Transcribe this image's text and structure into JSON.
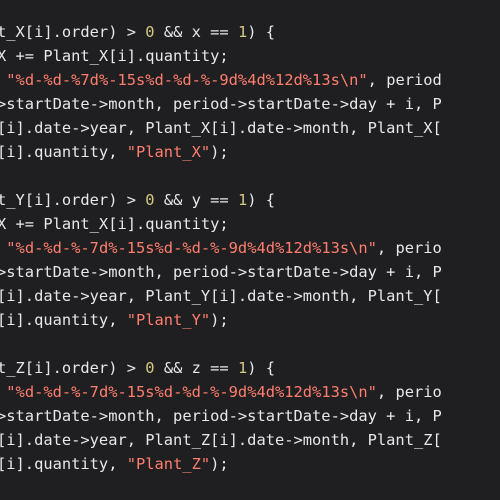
{
  "editor": {
    "theme": {
      "background": "#1f1f21",
      "text": "#e8e8e8",
      "number": "#d6c784",
      "string": "#ff7e6e"
    },
    "lines": [
      {
        "parts": [
          {
            "t": "plain",
            "v": "t_X[i].order) > "
          },
          {
            "t": "num",
            "v": "0"
          },
          {
            "t": "plain",
            "v": " && x == "
          },
          {
            "t": "num",
            "v": "1"
          },
          {
            "t": "plain",
            "v": ") {"
          }
        ]
      },
      {
        "parts": [
          {
            "t": "plain",
            "v": "X += Plant_X[i].quantity;"
          }
        ]
      },
      {
        "parts": [
          {
            "t": "plain",
            "v": " "
          },
          {
            "t": "str",
            "v": "\"%d-%d-%7d%-15s%d-%d-%-9d%4d%12d%13s\\n\""
          },
          {
            "t": "plain",
            "v": ", period"
          }
        ]
      },
      {
        "parts": [
          {
            "t": "plain",
            "v": ">startDate->month, period->startDate->day + i, P"
          }
        ]
      },
      {
        "parts": [
          {
            "t": "plain",
            "v": "[i].date->year, Plant_X[i].date->month, Plant_X["
          }
        ]
      },
      {
        "parts": [
          {
            "t": "plain",
            "v": "[i].quantity, "
          },
          {
            "t": "str",
            "v": "\"Plant_X\""
          },
          {
            "t": "plain",
            "v": ");"
          }
        ]
      },
      {
        "parts": []
      },
      {
        "parts": [
          {
            "t": "plain",
            "v": "t_Y[i].order) > "
          },
          {
            "t": "num",
            "v": "0"
          },
          {
            "t": "plain",
            "v": " && y == "
          },
          {
            "t": "num",
            "v": "1"
          },
          {
            "t": "plain",
            "v": ") {"
          }
        ]
      },
      {
        "parts": [
          {
            "t": "plain",
            "v": "X += Plant_X[i].quantity;"
          }
        ]
      },
      {
        "parts": [
          {
            "t": "plain",
            "v": " "
          },
          {
            "t": "str",
            "v": "\"%d-%d-%-7d%-15s%d-%d-%-9d%4d%12d%13s\\n\""
          },
          {
            "t": "plain",
            "v": ", perio"
          }
        ]
      },
      {
        "parts": [
          {
            "t": "plain",
            "v": ">startDate->month, period->startDate->day + i, P"
          }
        ]
      },
      {
        "parts": [
          {
            "t": "plain",
            "v": "[i].date->year, Plant_Y[i].date->month, Plant_Y["
          }
        ]
      },
      {
        "parts": [
          {
            "t": "plain",
            "v": "[i].quantity, "
          },
          {
            "t": "str",
            "v": "\"Plant_Y\""
          },
          {
            "t": "plain",
            "v": ");"
          }
        ]
      },
      {
        "parts": []
      },
      {
        "parts": [
          {
            "t": "plain",
            "v": "t_Z[i].order) > "
          },
          {
            "t": "num",
            "v": "0"
          },
          {
            "t": "plain",
            "v": " && z == "
          },
          {
            "t": "num",
            "v": "1"
          },
          {
            "t": "plain",
            "v": ") {"
          }
        ]
      },
      {
        "parts": [
          {
            "t": "plain",
            "v": " "
          },
          {
            "t": "str",
            "v": "\"%d-%d-%-7d%-15s%d-%d-%-9d%4d%12d%13s\\n\""
          },
          {
            "t": "plain",
            "v": ", perio"
          }
        ]
      },
      {
        "parts": [
          {
            "t": "plain",
            "v": ">startDate->month, period->startDate->day + i, P"
          }
        ]
      },
      {
        "parts": [
          {
            "t": "plain",
            "v": "[i].date->year, Plant_Z[i].date->month, Plant_Z["
          }
        ]
      },
      {
        "parts": [
          {
            "t": "plain",
            "v": "[i].quantity, "
          },
          {
            "t": "str",
            "v": "\"Plant_Z\""
          },
          {
            "t": "plain",
            "v": ");"
          }
        ]
      }
    ]
  }
}
